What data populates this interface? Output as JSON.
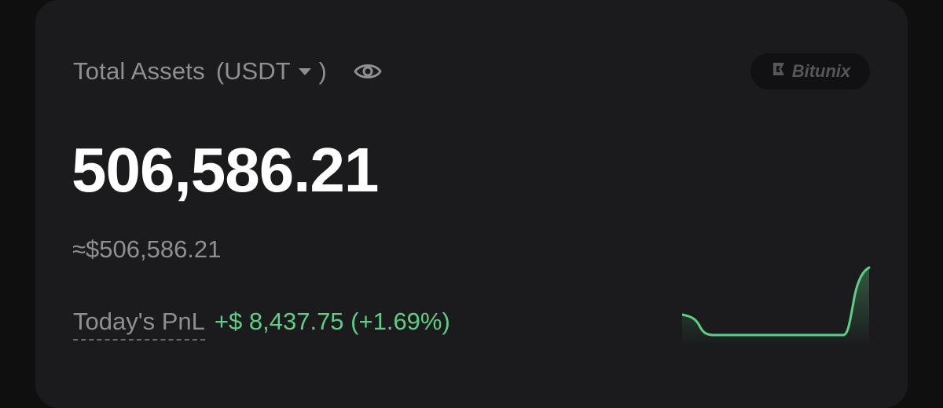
{
  "header": {
    "title": "Total Assets",
    "open_paren": "(",
    "unit": "USDT",
    "close_paren": ")",
    "visibility_icon": "eye-icon"
  },
  "brand": {
    "name": "Bitunix",
    "logo_icon": "bitunix-logo-icon"
  },
  "balance": {
    "amount": "506,586.21",
    "fiat_equivalent": "≈$506,586.21"
  },
  "pnl": {
    "label": "Today's PnL",
    "value": "+$ 8,437.75 (+1.69%)"
  },
  "colors": {
    "background": "#0f0f10",
    "card": "#1b1b1d",
    "positive": "#5fce85",
    "muted_text": "#8e8e93"
  }
}
